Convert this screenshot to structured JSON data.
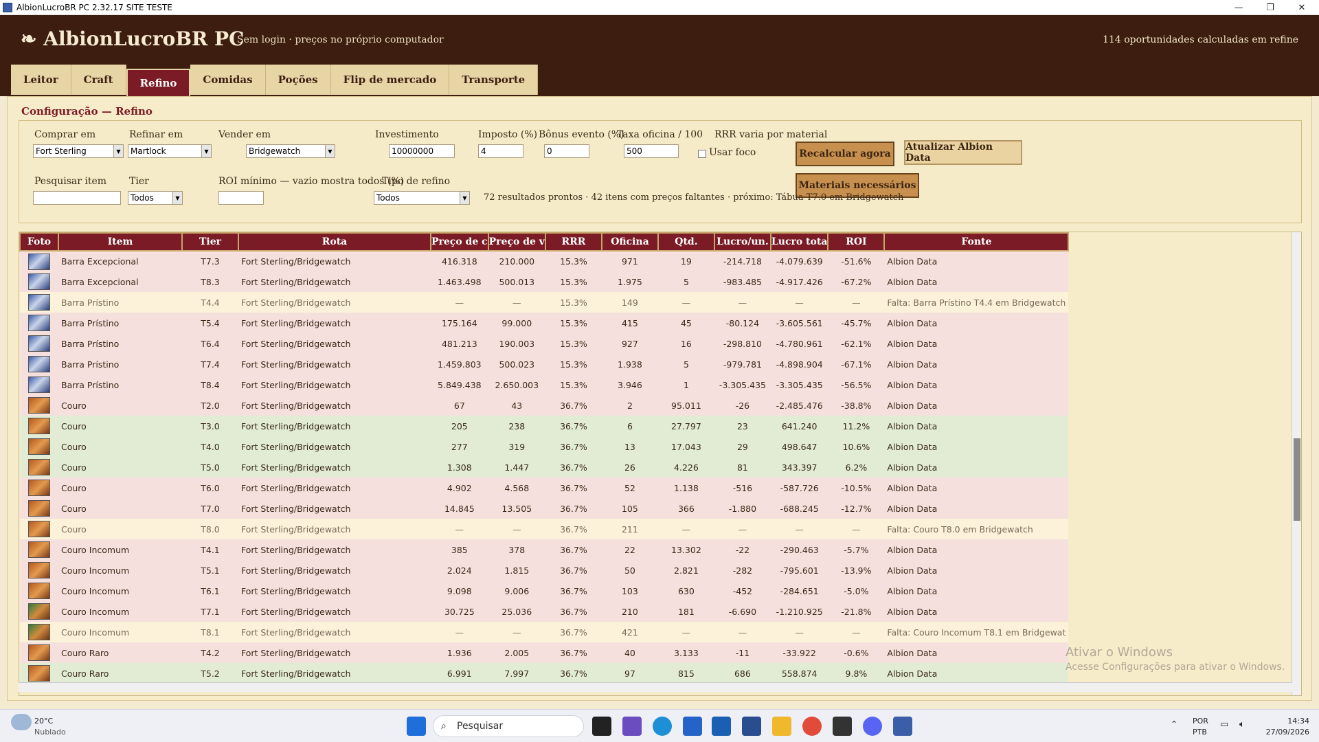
{
  "window": {
    "title": "AlbionLucroBR PC 2.32.17 SITE TESTE",
    "min": "—",
    "max": "❐",
    "close": "✕"
  },
  "header": {
    "logo_glyph": "❧",
    "logo": "AlbionLucroBR PC",
    "subtitle": "Sem login · preços no próprio computador",
    "summary": "114 oportunidades calculadas em refine"
  },
  "tabs": [
    "Leitor",
    "Craft",
    "Refino",
    "Comidas",
    "Poções",
    "Flip de mercado",
    "Transporte"
  ],
  "active_tab": "Refino",
  "config": {
    "title": "Configuração — Refino",
    "comprar_label": "Comprar em",
    "comprar_value": "Fort Sterling",
    "refinar_label": "Refinar em",
    "refinar_value": "Martlock",
    "vender_label": "Vender em",
    "vender_value": "Bridgewatch",
    "invest_label": "Investimento",
    "invest_value": "10000000",
    "imposto_label": "Imposto (%)",
    "imposto_value": "4",
    "bonus_label": "Bônus evento (%)",
    "bonus_value": "0",
    "taxa_label": "Taxa oficina / 100",
    "taxa_value": "500",
    "rrr_label": "RRR varia por material",
    "foco_label": "Usar foco",
    "recalc_button": "Recalcular agora",
    "atualizar_button": "Atualizar Albion Data",
    "materiais_button": "Materiais necessários",
    "search_label": "Pesquisar item",
    "search_value": "",
    "tier_label": "Tier",
    "tier_value": "Todos",
    "roi_label": "ROI mínimo — vazio mostra todos (%)",
    "roi_value": "",
    "tipo_label": "Tipo de refino",
    "tipo_value": "Todos",
    "status": "72 resultados prontos · 42 itens com preços faltantes · próximo: Tábua T7.0 em Bridgewatch"
  },
  "table": {
    "columns": [
      "Foto",
      "Item",
      "Tier",
      "Rota",
      "Preço de c",
      "Preço de v",
      "RRR",
      "Oficina",
      "Qtd.",
      "Lucro/un.",
      "Lucro tota",
      "ROI",
      "Fonte"
    ],
    "rows": [
      {
        "kind": "bar",
        "state": "neg",
        "item": "Barra Excepcional",
        "tier": "T7.3",
        "rota": "Fort Sterling/Bridgewatch",
        "pc": "416.318",
        "pv": "210.000",
        "rrr": "15.3%",
        "oficina": "971",
        "qtd": "19",
        "lu": "-214.718",
        "lt": "-4.079.639",
        "roi": "-51.6%",
        "fonte": "Albion Data"
      },
      {
        "kind": "bar",
        "state": "neg",
        "item": "Barra Excepcional",
        "tier": "T8.3",
        "rota": "Fort Sterling/Bridgewatch",
        "pc": "1.463.498",
        "pv": "500.013",
        "rrr": "15.3%",
        "oficina": "1.975",
        "qtd": "5",
        "lu": "-983.485",
        "lt": "-4.917.426",
        "roi": "-67.2%",
        "fonte": "Albion Data"
      },
      {
        "kind": "bar",
        "state": "miss",
        "item": "Barra Prístino",
        "tier": "T4.4",
        "rota": "Fort Sterling/Bridgewatch",
        "pc": "—",
        "pv": "—",
        "rrr": "15.3%",
        "oficina": "149",
        "qtd": "—",
        "lu": "—",
        "lt": "—",
        "roi": "—",
        "fonte": "Falta: Barra Prístino T4.4 em Bridgewatch"
      },
      {
        "kind": "bar",
        "state": "neg",
        "item": "Barra Prístino",
        "tier": "T5.4",
        "rota": "Fort Sterling/Bridgewatch",
        "pc": "175.164",
        "pv": "99.000",
        "rrr": "15.3%",
        "oficina": "415",
        "qtd": "45",
        "lu": "-80.124",
        "lt": "-3.605.561",
        "roi": "-45.7%",
        "fonte": "Albion Data"
      },
      {
        "kind": "bar",
        "state": "neg",
        "item": "Barra Prístino",
        "tier": "T6.4",
        "rota": "Fort Sterling/Bridgewatch",
        "pc": "481.213",
        "pv": "190.003",
        "rrr": "15.3%",
        "oficina": "927",
        "qtd": "16",
        "lu": "-298.810",
        "lt": "-4.780.961",
        "roi": "-62.1%",
        "fonte": "Albion Data"
      },
      {
        "kind": "bar",
        "state": "neg",
        "item": "Barra Prístino",
        "tier": "T7.4",
        "rota": "Fort Sterling/Bridgewatch",
        "pc": "1.459.803",
        "pv": "500.023",
        "rrr": "15.3%",
        "oficina": "1.938",
        "qtd": "5",
        "lu": "-979.781",
        "lt": "-4.898.904",
        "roi": "-67.1%",
        "fonte": "Albion Data"
      },
      {
        "kind": "bar",
        "state": "neg",
        "item": "Barra Prístino",
        "tier": "T8.4",
        "rota": "Fort Sterling/Bridgewatch",
        "pc": "5.849.438",
        "pv": "2.650.003",
        "rrr": "15.3%",
        "oficina": "3.946",
        "qtd": "1",
        "lu": "-3.305.435",
        "lt": "-3.305.435",
        "roi": "-56.5%",
        "fonte": "Albion Data"
      },
      {
        "kind": "leather",
        "state": "neg",
        "item": "Couro",
        "tier": "T2.0",
        "rota": "Fort Sterling/Bridgewatch",
        "pc": "67",
        "pv": "43",
        "rrr": "36.7%",
        "oficina": "2",
        "qtd": "95.011",
        "lu": "-26",
        "lt": "-2.485.476",
        "roi": "-38.8%",
        "fonte": "Albion Data"
      },
      {
        "kind": "leather",
        "state": "pos",
        "item": "Couro",
        "tier": "T3.0",
        "rota": "Fort Sterling/Bridgewatch",
        "pc": "205",
        "pv": "238",
        "rrr": "36.7%",
        "oficina": "6",
        "qtd": "27.797",
        "lu": "23",
        "lt": "641.240",
        "roi": "11.2%",
        "fonte": "Albion Data"
      },
      {
        "kind": "leather",
        "state": "pos",
        "item": "Couro",
        "tier": "T4.0",
        "rota": "Fort Sterling/Bridgewatch",
        "pc": "277",
        "pv": "319",
        "rrr": "36.7%",
        "oficina": "13",
        "qtd": "17.043",
        "lu": "29",
        "lt": "498.647",
        "roi": "10.6%",
        "fonte": "Albion Data"
      },
      {
        "kind": "leather",
        "state": "pos",
        "item": "Couro",
        "tier": "T5.0",
        "rota": "Fort Sterling/Bridgewatch",
        "pc": "1.308",
        "pv": "1.447",
        "rrr": "36.7%",
        "oficina": "26",
        "qtd": "4.226",
        "lu": "81",
        "lt": "343.397",
        "roi": "6.2%",
        "fonte": "Albion Data"
      },
      {
        "kind": "leather",
        "state": "neg",
        "item": "Couro",
        "tier": "T6.0",
        "rota": "Fort Sterling/Bridgewatch",
        "pc": "4.902",
        "pv": "4.568",
        "rrr": "36.7%",
        "oficina": "52",
        "qtd": "1.138",
        "lu": "-516",
        "lt": "-587.726",
        "roi": "-10.5%",
        "fonte": "Albion Data"
      },
      {
        "kind": "leather",
        "state": "neg",
        "item": "Couro",
        "tier": "T7.0",
        "rota": "Fort Sterling/Bridgewatch",
        "pc": "14.845",
        "pv": "13.505",
        "rrr": "36.7%",
        "oficina": "105",
        "qtd": "366",
        "lu": "-1.880",
        "lt": "-688.245",
        "roi": "-12.7%",
        "fonte": "Albion Data"
      },
      {
        "kind": "leather",
        "state": "miss",
        "item": "Couro",
        "tier": "T8.0",
        "rota": "Fort Sterling/Bridgewatch",
        "pc": "—",
        "pv": "—",
        "rrr": "36.7%",
        "oficina": "211",
        "qtd": "—",
        "lu": "—",
        "lt": "—",
        "roi": "—",
        "fonte": "Falta: Couro T8.0 em Bridgewatch"
      },
      {
        "kind": "leather",
        "state": "neg",
        "item": "Couro Incomum",
        "tier": "T4.1",
        "rota": "Fort Sterling/Bridgewatch",
        "pc": "385",
        "pv": "378",
        "rrr": "36.7%",
        "oficina": "22",
        "qtd": "13.302",
        "lu": "-22",
        "lt": "-290.463",
        "roi": "-5.7%",
        "fonte": "Albion Data"
      },
      {
        "kind": "leather",
        "state": "neg",
        "item": "Couro Incomum",
        "tier": "T5.1",
        "rota": "Fort Sterling/Bridgewatch",
        "pc": "2.024",
        "pv": "1.815",
        "rrr": "36.7%",
        "oficina": "50",
        "qtd": "2.821",
        "lu": "-282",
        "lt": "-795.601",
        "roi": "-13.9%",
        "fonte": "Albion Data"
      },
      {
        "kind": "leather",
        "state": "neg",
        "item": "Couro Incomum",
        "tier": "T6.1",
        "rota": "Fort Sterling/Bridgewatch",
        "pc": "9.098",
        "pv": "9.006",
        "rrr": "36.7%",
        "oficina": "103",
        "qtd": "630",
        "lu": "-452",
        "lt": "-284.651",
        "roi": "-5.0%",
        "fonte": "Albion Data"
      },
      {
        "kind": "leather-g",
        "state": "neg",
        "item": "Couro Incomum",
        "tier": "T7.1",
        "rota": "Fort Sterling/Bridgewatch",
        "pc": "30.725",
        "pv": "25.036",
        "rrr": "36.7%",
        "oficina": "210",
        "qtd": "181",
        "lu": "-6.690",
        "lt": "-1.210.925",
        "roi": "-21.8%",
        "fonte": "Albion Data"
      },
      {
        "kind": "leather-g",
        "state": "miss",
        "item": "Couro Incomum",
        "tier": "T8.1",
        "rota": "Fort Sterling/Bridgewatch",
        "pc": "—",
        "pv": "—",
        "rrr": "36.7%",
        "oficina": "421",
        "qtd": "—",
        "lu": "—",
        "lt": "—",
        "roi": "—",
        "fonte": "Falta: Couro Incomum T8.1 em Bridgewat"
      },
      {
        "kind": "leather",
        "state": "neg",
        "item": "Couro Raro",
        "tier": "T4.2",
        "rota": "Fort Sterling/Bridgewatch",
        "pc": "1.936",
        "pv": "2.005",
        "rrr": "36.7%",
        "oficina": "40",
        "qtd": "3.133",
        "lu": "-11",
        "lt": "-33.922",
        "roi": "-0.6%",
        "fonte": "Albion Data"
      },
      {
        "kind": "leather",
        "state": "pos",
        "item": "Couro Raro",
        "tier": "T5.2",
        "rota": "Fort Sterling/Bridgewatch",
        "pc": "6.991",
        "pv": "7.997",
        "rrr": "36.7%",
        "oficina": "97",
        "qtd": "815",
        "lu": "686",
        "lt": "558.874",
        "roi": "9.8%",
        "fonte": "Albion Data"
      }
    ]
  },
  "watermark": {
    "line1": "Ativar o Windows",
    "line2": "Acesse Configurações para ativar o Windows."
  },
  "taskbar": {
    "temp": "20°C",
    "weather": "Nublado",
    "search": "Pesquisar",
    "lang1": "POR",
    "lang2": "PTB",
    "time": "14:34",
    "date": "27/09/2026"
  }
}
